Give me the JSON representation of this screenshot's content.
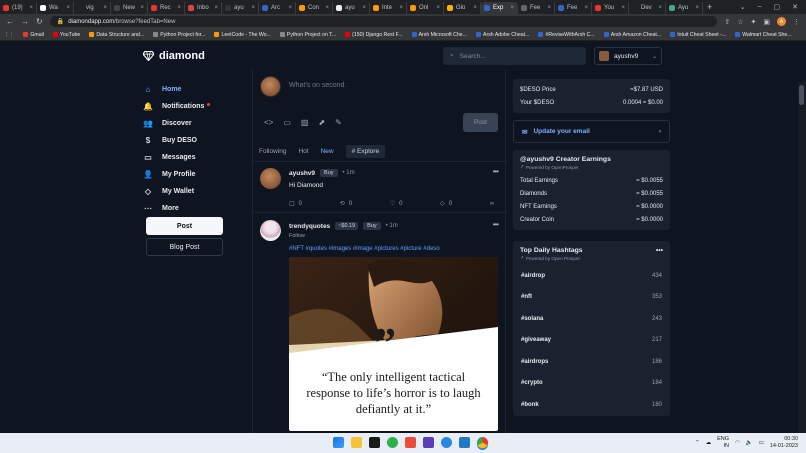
{
  "browser": {
    "tabs": [
      {
        "label": "(19)",
        "color": "#e33"
      },
      {
        "label": "Wa",
        "color": "#fff"
      },
      {
        "label": "vig",
        "color": "#222"
      },
      {
        "label": "New",
        "color": "#444"
      },
      {
        "label": "Rec",
        "color": "#e33"
      },
      {
        "label": "Inbo",
        "color": "#d44"
      },
      {
        "label": "ayu",
        "color": "#333"
      },
      {
        "label": "Arc",
        "color": "#36c"
      },
      {
        "label": "Con",
        "color": "#f90"
      },
      {
        "label": "ayu",
        "color": "#eee"
      },
      {
        "label": "Inte",
        "color": "#f90"
      },
      {
        "label": "Onl",
        "color": "#f90"
      },
      {
        "label": "Glo",
        "color": "#ffb000"
      },
      {
        "label": "Exp",
        "color": "#36c"
      },
      {
        "label": "Fee",
        "color": "#666"
      },
      {
        "label": "Fee",
        "color": "#36c"
      },
      {
        "label": "You",
        "color": "#e33"
      },
      {
        "label": "Dev",
        "color": "#222"
      },
      {
        "label": "Ayu",
        "color": "#4a8"
      }
    ],
    "url_host": "diamondapp.com",
    "url_path": "/browse?feedTab=New",
    "profile_letter": "A",
    "bookmarks": [
      {
        "label": "Gmail",
        "color": "#e33"
      },
      {
        "label": "YouTube",
        "color": "#e00"
      },
      {
        "label": "Data Structure and...",
        "color": "#f90"
      },
      {
        "label": "Python Project for...",
        "color": "#888"
      },
      {
        "label": "LeetCode - The Wo...",
        "color": "#f90"
      },
      {
        "label": "Python Project on T...",
        "color": "#888"
      },
      {
        "label": "(150) Django Rest F...",
        "color": "#e00"
      },
      {
        "label": "Arsh Microsoft Che...",
        "color": "#36c"
      },
      {
        "label": "Arsh Adobe Cheat...",
        "color": "#36c"
      },
      {
        "label": "#ReviseWithArsh C...",
        "color": "#36c"
      },
      {
        "label": "Arsh Amazon Cheat...",
        "color": "#36c"
      },
      {
        "label": "Intuit Cheat Sheet -...",
        "color": "#36c"
      },
      {
        "label": "Walmart Cheat She...",
        "color": "#36c"
      }
    ]
  },
  "app": {
    "logo_text": "diamond",
    "search_placeholder": "Search...",
    "username": "ayushv9"
  },
  "sidebar": {
    "items": [
      {
        "label": "Home",
        "icon": "home-icon",
        "glyph": "⌂"
      },
      {
        "label": "Notifications",
        "icon": "bell-icon",
        "glyph": "🔔"
      },
      {
        "label": "Discover",
        "icon": "users-icon",
        "glyph": "👥"
      },
      {
        "label": "Buy DESO",
        "icon": "dollar-icon",
        "glyph": "$"
      },
      {
        "label": "Messages",
        "icon": "message-icon",
        "glyph": "▭"
      },
      {
        "label": "My Profile",
        "icon": "user-icon",
        "glyph": "👤"
      },
      {
        "label": "My Wallet",
        "icon": "diamond-icon",
        "glyph": "◇"
      },
      {
        "label": "More",
        "icon": "more-icon",
        "glyph": "⋯"
      }
    ],
    "post_label": "Post",
    "blog_label": "Blog Post"
  },
  "composer": {
    "placeholder": "What's on second.",
    "post_label": "Post"
  },
  "feed_tabs": {
    "following": "Following",
    "hot": "Hot",
    "new": "New",
    "explore": "# Explore"
  },
  "posts": [
    {
      "author": "ayushv9",
      "buy": "Buy",
      "time": "1m",
      "text": "Hi Diamond",
      "comments": "0",
      "reposts": "0",
      "likes": "0",
      "diamonds": "0"
    },
    {
      "author": "trendyquotes",
      "price": "~$0.19",
      "buy": "Buy",
      "time": "1m",
      "follow": "Follow",
      "tags": "#NFT #quotes #images #image #pictures #picture #deso",
      "quote": "“The only intelligent tactical response to life’s horror is to laugh defiantly at it.”"
    }
  ],
  "wallet": {
    "price_label": "$DESO Price",
    "price_value": "≈$7.87 USD",
    "your_label": "Your $DESO",
    "your_value": "0.0004 ≈ $0.00"
  },
  "email": {
    "label": "Update your email"
  },
  "earnings": {
    "title": "@ayushv9 Creator Earnings",
    "powered": "Powered by OpenProsper",
    "rows": [
      {
        "label": "Total Earnings",
        "value": "≈ $0.0055"
      },
      {
        "label": "Diamonds",
        "value": "≈ $0.0055"
      },
      {
        "label": "NFT Earnings",
        "value": "≈ $0.0000"
      },
      {
        "label": "Creator Coin",
        "value": "≈ $0.0000"
      }
    ]
  },
  "hashtags": {
    "title": "Top Daily Hashtags",
    "powered": "Powered by Open Prosper",
    "rows": [
      {
        "tag": "#airdrop",
        "count": "434"
      },
      {
        "tag": "#nft",
        "count": "353"
      },
      {
        "tag": "#solana",
        "count": "243"
      },
      {
        "tag": "#giveaway",
        "count": "217"
      },
      {
        "tag": "#airdrops",
        "count": "186"
      },
      {
        "tag": "#crypto",
        "count": "184"
      },
      {
        "tag": "#bonk",
        "count": "180"
      }
    ]
  },
  "taskbar": {
    "lang": "ENG",
    "region": "IN",
    "time": "00:30",
    "date": "14-01-2023"
  }
}
